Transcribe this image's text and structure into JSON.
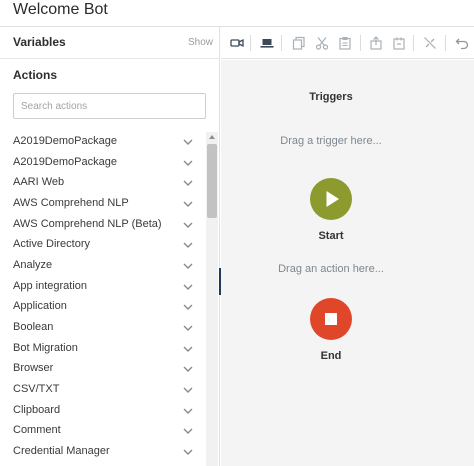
{
  "window": {
    "title": "Welcome Bot"
  },
  "variables": {
    "label": "Variables",
    "show_label": "Show"
  },
  "actions": {
    "label": "Actions",
    "search_placeholder": "Search actions",
    "items": [
      "A2019DemoPackage",
      "A2019DemoPackage",
      "AARI Web",
      "AWS Comprehend NLP",
      "AWS Comprehend NLP (Beta)",
      "Active Directory",
      "Analyze",
      "App integration",
      "Application",
      "Boolean",
      "Bot Migration",
      "Browser",
      "CSV/TXT",
      "Clipboard",
      "Comment",
      "Credential Manager"
    ],
    "expand_icon": "chevron-down-icon"
  },
  "toolbar": {
    "icons": [
      "video-camera-icon",
      "laptop-icon",
      "copy-icon",
      "cut-icon",
      "paste-icon",
      "enable-icon",
      "disable-icon",
      "unlink-icon",
      "undo-icon"
    ]
  },
  "canvas": {
    "triggers_label": "Triggers",
    "drag_trigger_text": "Drag a trigger here...",
    "start_label": "Start",
    "drag_action_text": "Drag an action here...",
    "end_label": "End"
  },
  "colors": {
    "start": "#8c9a2e",
    "end": "#e0472a",
    "canvas_bg": "#f4f4f4",
    "splitter": "#1f3b57"
  }
}
